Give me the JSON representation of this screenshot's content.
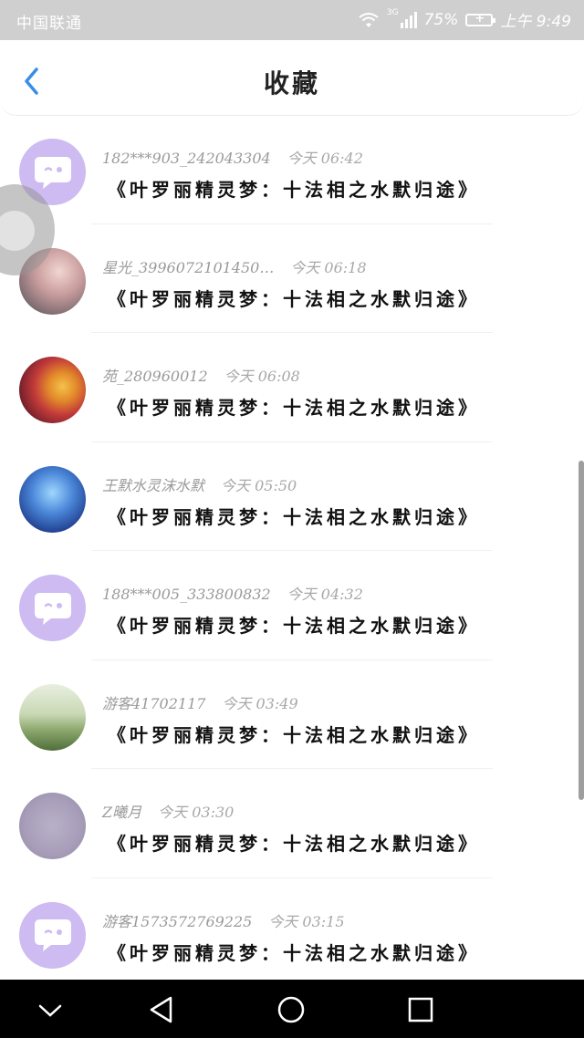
{
  "status_bar": {
    "carrier": "中国联通",
    "network": "3G",
    "battery": "75%",
    "time": "上午 9:49"
  },
  "header": {
    "title": "收藏",
    "back_icon": "chevron-left-icon"
  },
  "items": [
    {
      "user": "182***903_242043304",
      "time": "今天 06:42",
      "book": "《叶罗丽精灵梦：十法相之水默归途》",
      "avatar": "chat"
    },
    {
      "user": "星光_3996072101450…",
      "time": "今天 06:18",
      "book": "《叶罗丽精灵梦：十法相之水默归途》",
      "avatar": "anime"
    },
    {
      "user": "苑_280960012",
      "time": "今天 06:08",
      "book": "《叶罗丽精灵梦：十法相之水默归途》",
      "avatar": "flower"
    },
    {
      "user": "王默水灵沫水默",
      "time": "今天 05:50",
      "book": "《叶罗丽精灵梦：十法相之水默归途》",
      "avatar": "fairy"
    },
    {
      "user": "188***005_333800832",
      "time": "今天 04:32",
      "book": "《叶罗丽精灵梦：十法相之水默归途》",
      "avatar": "chat"
    },
    {
      "user": "游客41702117",
      "time": "今天 03:49",
      "book": "《叶罗丽精灵梦：十法相之水默归途》",
      "avatar": "photo"
    },
    {
      "user": "Z曦月",
      "time": "今天 03:30",
      "book": "《叶罗丽精灵梦：十法相之水默归途》",
      "avatar": "text"
    },
    {
      "user": "游客1573572769225",
      "time": "今天 03:15",
      "book": "《叶罗丽精灵梦：十法相之水默归途》",
      "avatar": "chat"
    }
  ],
  "colors": {
    "accent": "#3a8ee6",
    "chat_avatar": "#cdbbf2",
    "status_bar": "#cfcfcf",
    "nav_bar": "#000000"
  },
  "nav_bar": {
    "icons": [
      "chevron-down-icon",
      "back-triangle-icon",
      "home-circle-icon",
      "recents-square-icon"
    ]
  }
}
